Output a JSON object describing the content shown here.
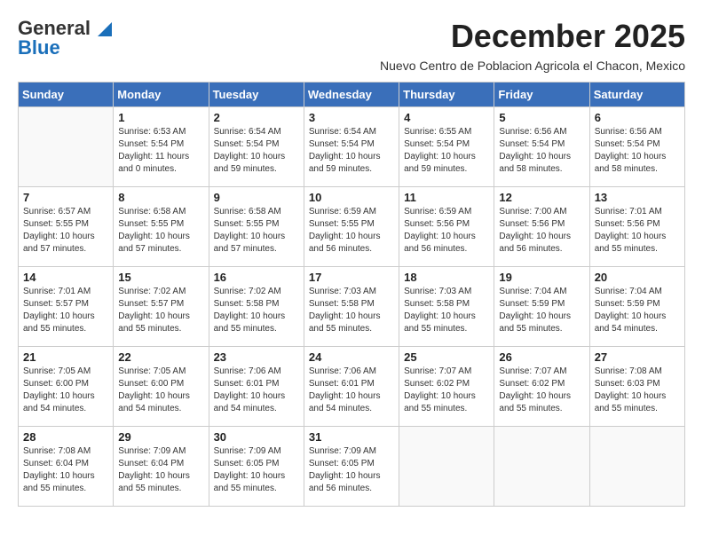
{
  "header": {
    "logo_general": "General",
    "logo_blue": "Blue",
    "month_title": "December 2025",
    "subtitle": "Nuevo Centro de Poblacion Agricola el Chacon, Mexico"
  },
  "days_of_week": [
    "Sunday",
    "Monday",
    "Tuesday",
    "Wednesday",
    "Thursday",
    "Friday",
    "Saturday"
  ],
  "weeks": [
    [
      {
        "day": "",
        "info": ""
      },
      {
        "day": "1",
        "info": "Sunrise: 6:53 AM\nSunset: 5:54 PM\nDaylight: 11 hours\nand 0 minutes."
      },
      {
        "day": "2",
        "info": "Sunrise: 6:54 AM\nSunset: 5:54 PM\nDaylight: 10 hours\nand 59 minutes."
      },
      {
        "day": "3",
        "info": "Sunrise: 6:54 AM\nSunset: 5:54 PM\nDaylight: 10 hours\nand 59 minutes."
      },
      {
        "day": "4",
        "info": "Sunrise: 6:55 AM\nSunset: 5:54 PM\nDaylight: 10 hours\nand 59 minutes."
      },
      {
        "day": "5",
        "info": "Sunrise: 6:56 AM\nSunset: 5:54 PM\nDaylight: 10 hours\nand 58 minutes."
      },
      {
        "day": "6",
        "info": "Sunrise: 6:56 AM\nSunset: 5:54 PM\nDaylight: 10 hours\nand 58 minutes."
      }
    ],
    [
      {
        "day": "7",
        "info": "Sunrise: 6:57 AM\nSunset: 5:55 PM\nDaylight: 10 hours\nand 57 minutes."
      },
      {
        "day": "8",
        "info": "Sunrise: 6:58 AM\nSunset: 5:55 PM\nDaylight: 10 hours\nand 57 minutes."
      },
      {
        "day": "9",
        "info": "Sunrise: 6:58 AM\nSunset: 5:55 PM\nDaylight: 10 hours\nand 57 minutes."
      },
      {
        "day": "10",
        "info": "Sunrise: 6:59 AM\nSunset: 5:55 PM\nDaylight: 10 hours\nand 56 minutes."
      },
      {
        "day": "11",
        "info": "Sunrise: 6:59 AM\nSunset: 5:56 PM\nDaylight: 10 hours\nand 56 minutes."
      },
      {
        "day": "12",
        "info": "Sunrise: 7:00 AM\nSunset: 5:56 PM\nDaylight: 10 hours\nand 56 minutes."
      },
      {
        "day": "13",
        "info": "Sunrise: 7:01 AM\nSunset: 5:56 PM\nDaylight: 10 hours\nand 55 minutes."
      }
    ],
    [
      {
        "day": "14",
        "info": "Sunrise: 7:01 AM\nSunset: 5:57 PM\nDaylight: 10 hours\nand 55 minutes."
      },
      {
        "day": "15",
        "info": "Sunrise: 7:02 AM\nSunset: 5:57 PM\nDaylight: 10 hours\nand 55 minutes."
      },
      {
        "day": "16",
        "info": "Sunrise: 7:02 AM\nSunset: 5:58 PM\nDaylight: 10 hours\nand 55 minutes."
      },
      {
        "day": "17",
        "info": "Sunrise: 7:03 AM\nSunset: 5:58 PM\nDaylight: 10 hours\nand 55 minutes."
      },
      {
        "day": "18",
        "info": "Sunrise: 7:03 AM\nSunset: 5:58 PM\nDaylight: 10 hours\nand 55 minutes."
      },
      {
        "day": "19",
        "info": "Sunrise: 7:04 AM\nSunset: 5:59 PM\nDaylight: 10 hours\nand 55 minutes."
      },
      {
        "day": "20",
        "info": "Sunrise: 7:04 AM\nSunset: 5:59 PM\nDaylight: 10 hours\nand 54 minutes."
      }
    ],
    [
      {
        "day": "21",
        "info": "Sunrise: 7:05 AM\nSunset: 6:00 PM\nDaylight: 10 hours\nand 54 minutes."
      },
      {
        "day": "22",
        "info": "Sunrise: 7:05 AM\nSunset: 6:00 PM\nDaylight: 10 hours\nand 54 minutes."
      },
      {
        "day": "23",
        "info": "Sunrise: 7:06 AM\nSunset: 6:01 PM\nDaylight: 10 hours\nand 54 minutes."
      },
      {
        "day": "24",
        "info": "Sunrise: 7:06 AM\nSunset: 6:01 PM\nDaylight: 10 hours\nand 54 minutes."
      },
      {
        "day": "25",
        "info": "Sunrise: 7:07 AM\nSunset: 6:02 PM\nDaylight: 10 hours\nand 55 minutes."
      },
      {
        "day": "26",
        "info": "Sunrise: 7:07 AM\nSunset: 6:02 PM\nDaylight: 10 hours\nand 55 minutes."
      },
      {
        "day": "27",
        "info": "Sunrise: 7:08 AM\nSunset: 6:03 PM\nDaylight: 10 hours\nand 55 minutes."
      }
    ],
    [
      {
        "day": "28",
        "info": "Sunrise: 7:08 AM\nSunset: 6:04 PM\nDaylight: 10 hours\nand 55 minutes."
      },
      {
        "day": "29",
        "info": "Sunrise: 7:09 AM\nSunset: 6:04 PM\nDaylight: 10 hours\nand 55 minutes."
      },
      {
        "day": "30",
        "info": "Sunrise: 7:09 AM\nSunset: 6:05 PM\nDaylight: 10 hours\nand 55 minutes."
      },
      {
        "day": "31",
        "info": "Sunrise: 7:09 AM\nSunset: 6:05 PM\nDaylight: 10 hours\nand 56 minutes."
      },
      {
        "day": "",
        "info": ""
      },
      {
        "day": "",
        "info": ""
      },
      {
        "day": "",
        "info": ""
      }
    ]
  ]
}
